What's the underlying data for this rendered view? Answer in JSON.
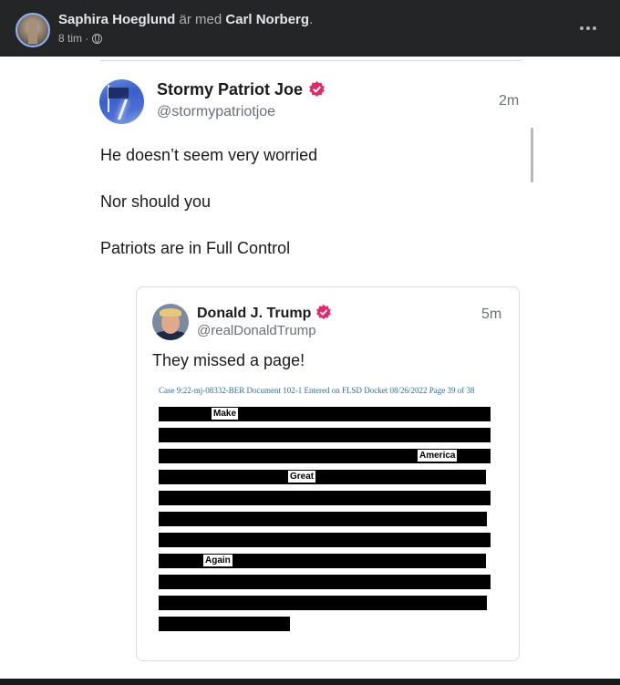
{
  "fb_header": {
    "author": "Saphira Hoeglund",
    "with_text": " är med ",
    "tagged": "Carl Norberg",
    "period": ".",
    "time": "8 tim ·",
    "privacy_icon": "globe-icon",
    "more_icon": "more-options-icon"
  },
  "tweet": {
    "name": "Stormy Patriot Joe",
    "handle": "@stormypatriotjoe",
    "time": "2m",
    "lines": [
      "He doesn’t seem very worried",
      "Nor should you",
      "Patriots are in Full Control"
    ]
  },
  "quoted": {
    "name": "Donald J. Trump",
    "handle": "@realDonaldTrump",
    "time": "5m",
    "text": "They missed a page!",
    "doc_header": "Case 9:22-mj-08332-BER Document 102-1 Entered on FLSD Docket 08/26/2022 Page 39 of 38",
    "words": [
      "Make",
      "America",
      "Great",
      "Again"
    ]
  },
  "colors": {
    "verified": "#e02a6b",
    "doc_header": "#2f6f9e",
    "fb_bg": "#242526"
  }
}
